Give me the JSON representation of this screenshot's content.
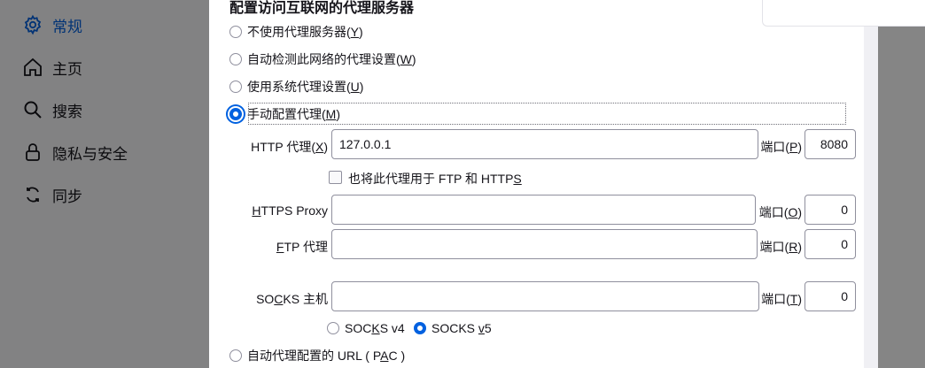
{
  "sidebar": {
    "items": [
      {
        "label": "常规",
        "icon": "gear-icon",
        "active": true
      },
      {
        "label": "主页",
        "icon": "home-icon",
        "active": false
      },
      {
        "label": "搜索",
        "icon": "search-icon",
        "active": false
      },
      {
        "label": "隐私与安全",
        "icon": "lock-icon",
        "active": false
      },
      {
        "label": "同步",
        "icon": "sync-icon",
        "active": false
      }
    ]
  },
  "dialog": {
    "heading": "配置访问互联网的代理服务器",
    "options": {
      "no_proxy": {
        "text": "不使用代理服务器(",
        "key": "Y",
        "end": ")"
      },
      "auto_detect": {
        "text": "自动检测此网络的代理设置(",
        "key": "W",
        "end": ")"
      },
      "system": {
        "text": "使用系统代理设置(",
        "key": "U",
        "end": ")"
      },
      "manual": {
        "text": "手动配置代理(",
        "key": "M",
        "end": ")",
        "checked": true
      },
      "auto_url": {
        "pre": "自动代理配置的 URL ( P",
        "key": "A",
        "end": "C )"
      }
    },
    "http": {
      "label_pre": "HTTP 代理(",
      "label_key": "X",
      "label_end": ")",
      "value": "127.0.0.1",
      "port_pre": "端口(",
      "port_key": "P",
      "port_end": ")",
      "port": "8080"
    },
    "also_use": {
      "pre": "也将此代理用于 FTP 和 HTTP",
      "key": "S",
      "checked": false
    },
    "https": {
      "label_key": "H",
      "label_rest": "TTPS Proxy",
      "value": "",
      "port_pre": "端口(",
      "port_key": "O",
      "port_end": ")",
      "port": "0"
    },
    "ftp": {
      "label_key": "F",
      "label_rest": "TP 代理",
      "value": "",
      "port_pre": "端口(",
      "port_key": "R",
      "port_end": ")",
      "port": "0"
    },
    "socks": {
      "label_pre": "SO",
      "label_key": "C",
      "label_rest": "KS 主机",
      "value": "",
      "port_pre": "端口(",
      "port_key": "T",
      "port_end": ")",
      "port": "0"
    },
    "socks_v4": {
      "pre": "SOC",
      "key": "K",
      "rest": "S v4",
      "checked": false
    },
    "socks_v5": {
      "pre": "SOCKS ",
      "key": "v",
      "rest": "5",
      "checked": true
    }
  },
  "colors": {
    "accent": "#0061e0",
    "overlay": "rgba(0,0,0,0.48)"
  }
}
